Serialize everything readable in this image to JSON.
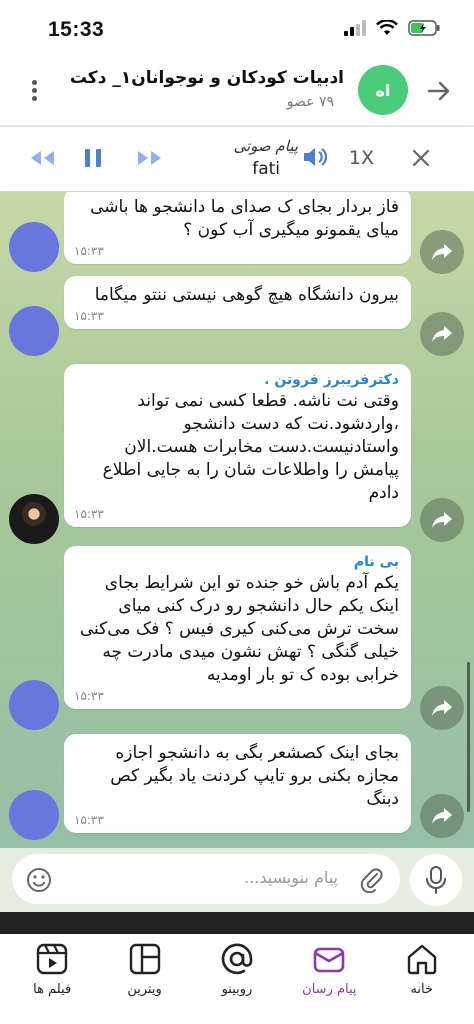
{
  "status_bar": {
    "time": "15:33"
  },
  "header": {
    "title": "ادبیات کودکان و نوجوانان۱_ دکت",
    "subtitle": "۷۹ عضو",
    "avatar_text": "اه",
    "avatar_color": "#4ccb7a"
  },
  "player": {
    "title": "پیام صوتی",
    "name": "fati",
    "speed": "1X"
  },
  "messages": [
    {
      "sender": "",
      "text": "فاز بردار بجای ک صدای ما دانشجو ها باشی میای یقمونو میگیری آب کون ؟",
      "time": "۱۵:۳۳"
    },
    {
      "sender": "",
      "text": "بیرون دانشگاه هیچ گوهی نیستی ننتو میگاما",
      "time": "۱۵:۳۳"
    },
    {
      "sender": "دکترفریبرز فروتن .",
      "text": "وقتی نت ناشه. قطعا کسی نمی تواند ،واردشود.نت که دست دانشجو واستادنیست.دست مخابرات هست.الان پیامش را واطلاعات شان را به جایی اطلاع دادم",
      "time": "۱۵:۳۳"
    },
    {
      "sender": "بی نام",
      "text": "یکم آدم باش خو جنده تو این شرایط بجای اینک یکم حال دانشجو رو درک کنی میای سخت ترش می‌کنی کیری فیس ؟ فک می‌کنی خیلی گنگی ؟ تهش نشون میدی مادرت چه خرابی بوده ک تو بار اومدیه",
      "time": "۱۵:۳۳"
    },
    {
      "sender": "",
      "text": "بجای اینک کصشعر بگی به دانشجو اجازه مجازه بکنی برو تایپ کردنت یاد بگیر کص دبنگ",
      "time": "۱۵:۳۳"
    }
  ],
  "input": {
    "placeholder": "پیام بنویسید..."
  },
  "nav": [
    {
      "label": "فیلم ها",
      "icon": "film-icon"
    },
    {
      "label": "ویترین",
      "icon": "showcase-icon"
    },
    {
      "label": "روبینو",
      "icon": "at-icon"
    },
    {
      "label": "پیام رسان",
      "icon": "messenger-icon",
      "active": true
    },
    {
      "label": "خانه",
      "icon": "home-icon"
    }
  ],
  "colors": {
    "accent": "#8a3ba8",
    "sender": "#2a86c8",
    "player": "#4a7fd4"
  }
}
